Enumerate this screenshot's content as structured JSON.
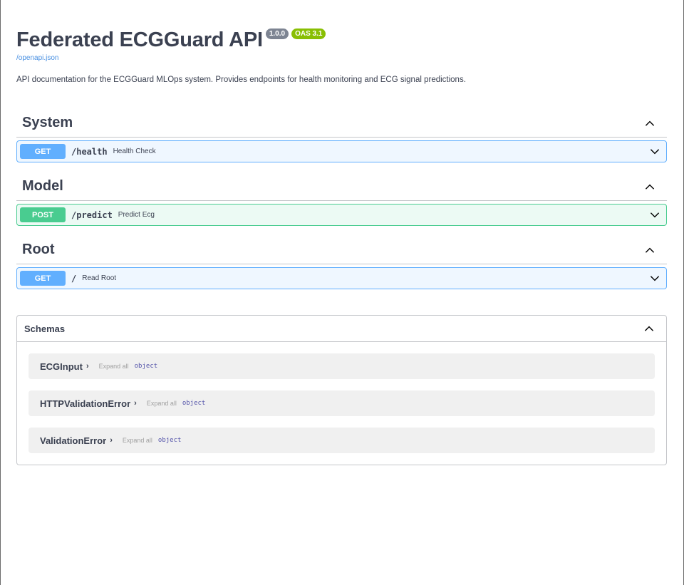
{
  "info": {
    "title": "Federated ECGGuard API",
    "version_badge": "1.0.0",
    "oas_badge": "OAS 3.1",
    "spec_link": "/openapi.json",
    "description": "API documentation for the ECGGuard MLOps system. Provides endpoints for health monitoring and ECG signal predictions."
  },
  "tags": [
    {
      "name": "System",
      "operations": [
        {
          "method": "GET",
          "path": "/health",
          "summary": "Health Check"
        }
      ]
    },
    {
      "name": "Model",
      "operations": [
        {
          "method": "POST",
          "path": "/predict",
          "summary": "Predict Ecg"
        }
      ]
    },
    {
      "name": "Root",
      "operations": [
        {
          "method": "GET",
          "path": "/",
          "summary": "Read Root"
        }
      ]
    }
  ],
  "schemas": {
    "title": "Schemas",
    "models": [
      {
        "name": "ECGInput",
        "expand_label": "Expand all",
        "type": "object"
      },
      {
        "name": "HTTPValidationError",
        "expand_label": "Expand all",
        "type": "object"
      },
      {
        "name": "ValidationError",
        "expand_label": "Expand all",
        "type": "object"
      }
    ]
  },
  "colors": {
    "get": "#61affe",
    "post": "#49cc90",
    "version_badge": "#7d8492",
    "oas_badge": "#89bf04",
    "link": "#4990e2"
  }
}
